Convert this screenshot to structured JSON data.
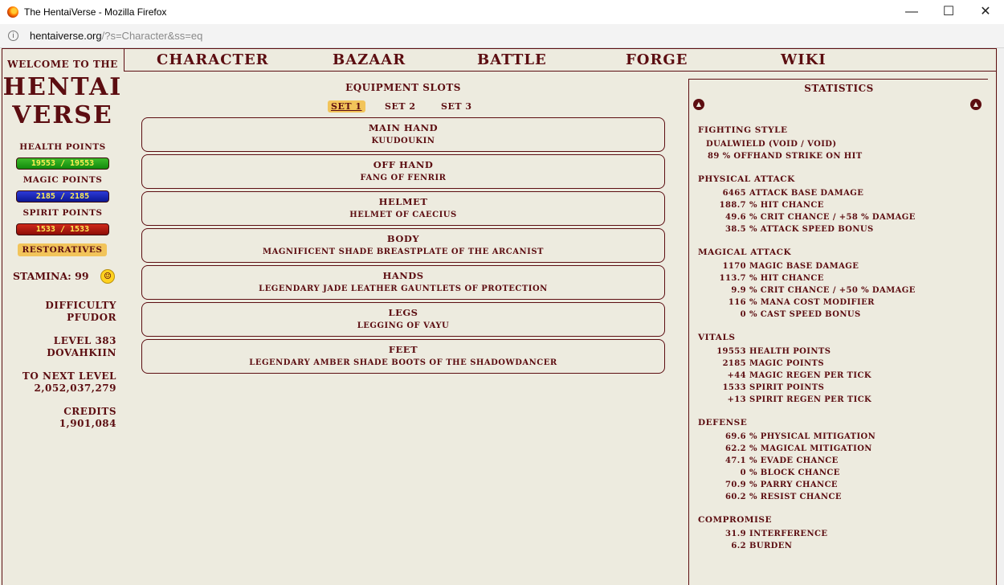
{
  "browser": {
    "window_title": "The HentaiVerse - Mozilla Firefox",
    "url_host": "hentaiverse.org",
    "url_path": "/?s=Character&ss=eq",
    "minimize": "—",
    "maximize": "☐",
    "close": "✕"
  },
  "left": {
    "welcome": "Welcome to the",
    "logo_line1": "HENTAI",
    "logo_line2": "VERSE",
    "health_label": "Health points",
    "health_value": "19553 / 19553",
    "health_fraction": 1.0,
    "magic_label": "Magic points",
    "magic_value": "2185 / 2185",
    "magic_fraction": 1.0,
    "spirit_label": "Spirit points",
    "spirit_value": "1533 / 1533",
    "spirit_fraction": 1.0,
    "restoratives": "Restoratives",
    "stamina": "Stamina: 99",
    "difficulty_label": "Difficulty",
    "difficulty_value": "Pfudor",
    "level": "Level 383",
    "title": "Dovahkiin",
    "next_level_label": "To next level",
    "next_level_value": "2,052,037,279",
    "credits_label": "Credits",
    "credits_value": "1,901,084"
  },
  "nav": {
    "items": [
      "Character",
      "Bazaar",
      "Battle",
      "Forge",
      "Wiki"
    ]
  },
  "equipment": {
    "title": "Equipment Slots",
    "sets": [
      "Set 1",
      "Set 2",
      "Set 3"
    ],
    "active_set": "Set 1",
    "slots": [
      {
        "slot": "Main Hand",
        "item": "Kuudoukin"
      },
      {
        "slot": "Off Hand",
        "item": "Fang of Fenrir"
      },
      {
        "slot": "Helmet",
        "item": "Helmet of Caecius"
      },
      {
        "slot": "Body",
        "item": "Magnificent Shade Breastplate of the Arcanist"
      },
      {
        "slot": "Hands",
        "item": "Legendary Jade Leather Gauntlets of Protection"
      },
      {
        "slot": "Legs",
        "item": "Legging of Vayu"
      },
      {
        "slot": "Feet",
        "item": "Legendary Amber Shade Boots of the Shadowdancer"
      }
    ]
  },
  "statistics": {
    "title": "Statistics",
    "fighting_style": {
      "title": "Fighting Style",
      "line1": "Dualwield (Void / Void)",
      "line2": "89 % offhand strike on hit"
    },
    "physical": {
      "title": "Physical Attack",
      "rows": [
        {
          "value": "6465",
          "label": "attack base damage"
        },
        {
          "value": "188.7",
          "label": "% hit chance"
        },
        {
          "value": "49.6",
          "label": "% crit chance / +58 % damage"
        },
        {
          "value": "38.5",
          "label": "% attack speed bonus"
        }
      ]
    },
    "magical": {
      "title": "Magical Attack",
      "rows": [
        {
          "value": "1170",
          "label": "magic base damage"
        },
        {
          "value": "113.7",
          "label": "% hit chance"
        },
        {
          "value": "9.9",
          "label": "% crit chance / +50 % damage"
        },
        {
          "value": "116",
          "label": "% mana cost modifier"
        },
        {
          "value": "0",
          "label": "% cast speed bonus"
        }
      ]
    },
    "vitals": {
      "title": "Vitals",
      "rows": [
        {
          "value": "19553",
          "label": "health points"
        },
        {
          "value": "2185",
          "label": "magic points"
        },
        {
          "value": "+44",
          "label": "magic regen per tick"
        },
        {
          "value": "1533",
          "label": "spirit points"
        },
        {
          "value": "+13",
          "label": "spirit regen per tick"
        }
      ]
    },
    "defense": {
      "title": "Defense",
      "rows": [
        {
          "value": "69.6",
          "label": "% physical mitigation"
        },
        {
          "value": "62.2",
          "label": "% magical mitigation"
        },
        {
          "value": "47.1",
          "label": "% evade chance"
        },
        {
          "value": "0",
          "label": "% block chance"
        },
        {
          "value": "70.9",
          "label": "% parry chance"
        },
        {
          "value": "60.2",
          "label": "% resist chance"
        }
      ]
    },
    "compromise": {
      "title": "Compromise",
      "rows": [
        {
          "value": "31.9",
          "label": "interference"
        },
        {
          "value": "6.2",
          "label": "burden"
        }
      ]
    }
  },
  "colors": {
    "text": "#5c0d11",
    "background": "#edebdf",
    "highlight": "#f2c45a",
    "hp_bar": "#1e9a14",
    "mp_bar": "#1422b0",
    "sp_bar": "#a8170d"
  }
}
